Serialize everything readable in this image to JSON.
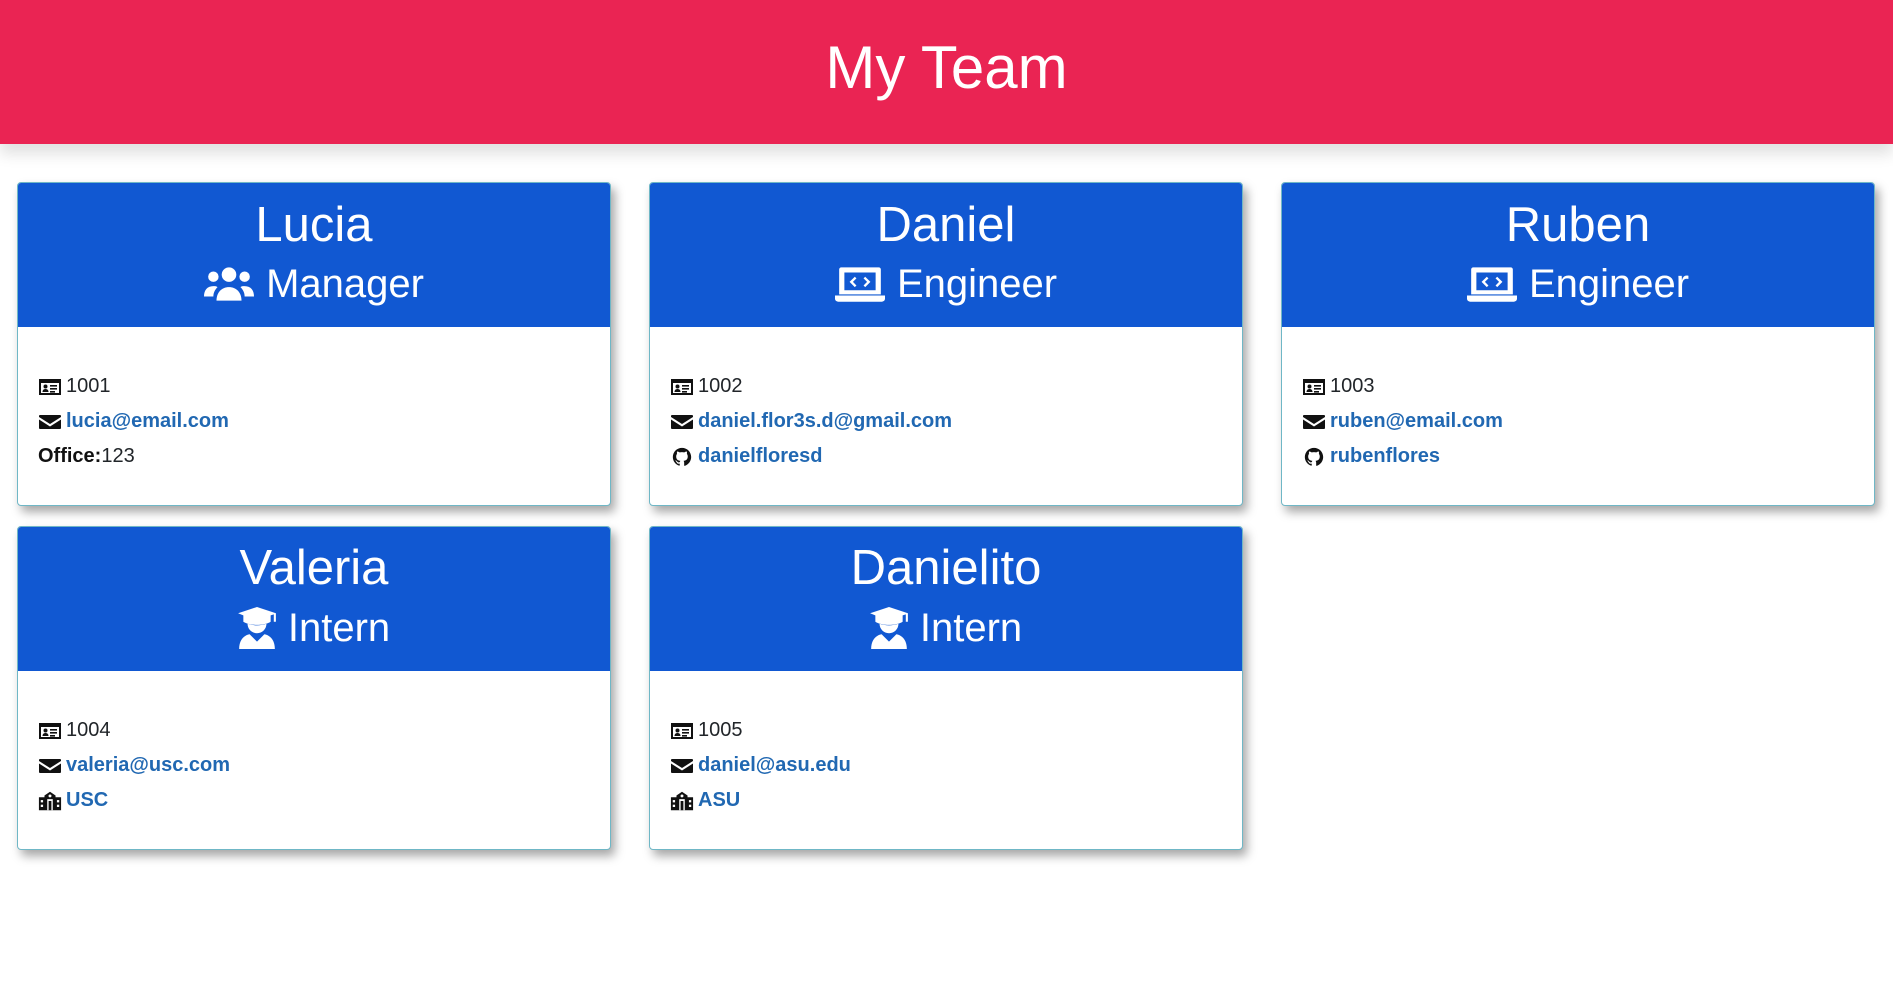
{
  "header": {
    "title": "My Team"
  },
  "team": [
    {
      "name": "Lucia",
      "role": "Manager",
      "role_icon": "users-icon",
      "id": "1001",
      "email": "lucia@email.com",
      "extra_type": "office",
      "office_label": "Office:",
      "office": "123"
    },
    {
      "name": "Daniel",
      "role": "Engineer",
      "role_icon": "laptop-code-icon",
      "id": "1002",
      "email": "daniel.flor3s.d@gmail.com",
      "extra_type": "github",
      "github": "danielfloresd"
    },
    {
      "name": "Ruben",
      "role": "Engineer",
      "role_icon": "laptop-code-icon",
      "id": "1003",
      "email": "ruben@email.com",
      "extra_type": "github",
      "github": "rubenflores"
    },
    {
      "name": "Valeria",
      "role": "Intern",
      "role_icon": "graduate-icon",
      "id": "1004",
      "email": "valeria@usc.com",
      "extra_type": "school",
      "school": "USC"
    },
    {
      "name": "Danielito",
      "role": "Intern",
      "role_icon": "graduate-icon",
      "id": "1005",
      "email": "daniel@asu.edu",
      "extra_type": "school",
      "school": "ASU"
    }
  ],
  "colors": {
    "header_bg": "#ea2453",
    "card_header_bg": "#1158d2",
    "link": "#2168b2"
  }
}
